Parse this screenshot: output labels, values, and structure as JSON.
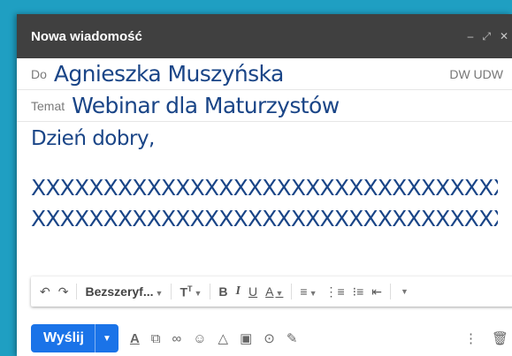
{
  "window": {
    "title": "Nowa wiadomość"
  },
  "recipients": {
    "to_label": "Do",
    "to_value": "Agnieszka Muszyńska",
    "cc_bcc": "DW UDW"
  },
  "subject": {
    "label": "Temat",
    "value": "Webinar dla Maturzystów"
  },
  "message": {
    "greeting": "Dzień dobry,",
    "lines": [
      "XXXXXXXXXXXXXXXXXXXXXXXXXXXXXXXXXX",
      "XXXXXXXXXXXXXXXXXXXXXXXXXXXXXXXXXX"
    ]
  },
  "format_bar": {
    "font_name": "Bezszeryf..."
  },
  "send": {
    "label": "Wyślij"
  }
}
